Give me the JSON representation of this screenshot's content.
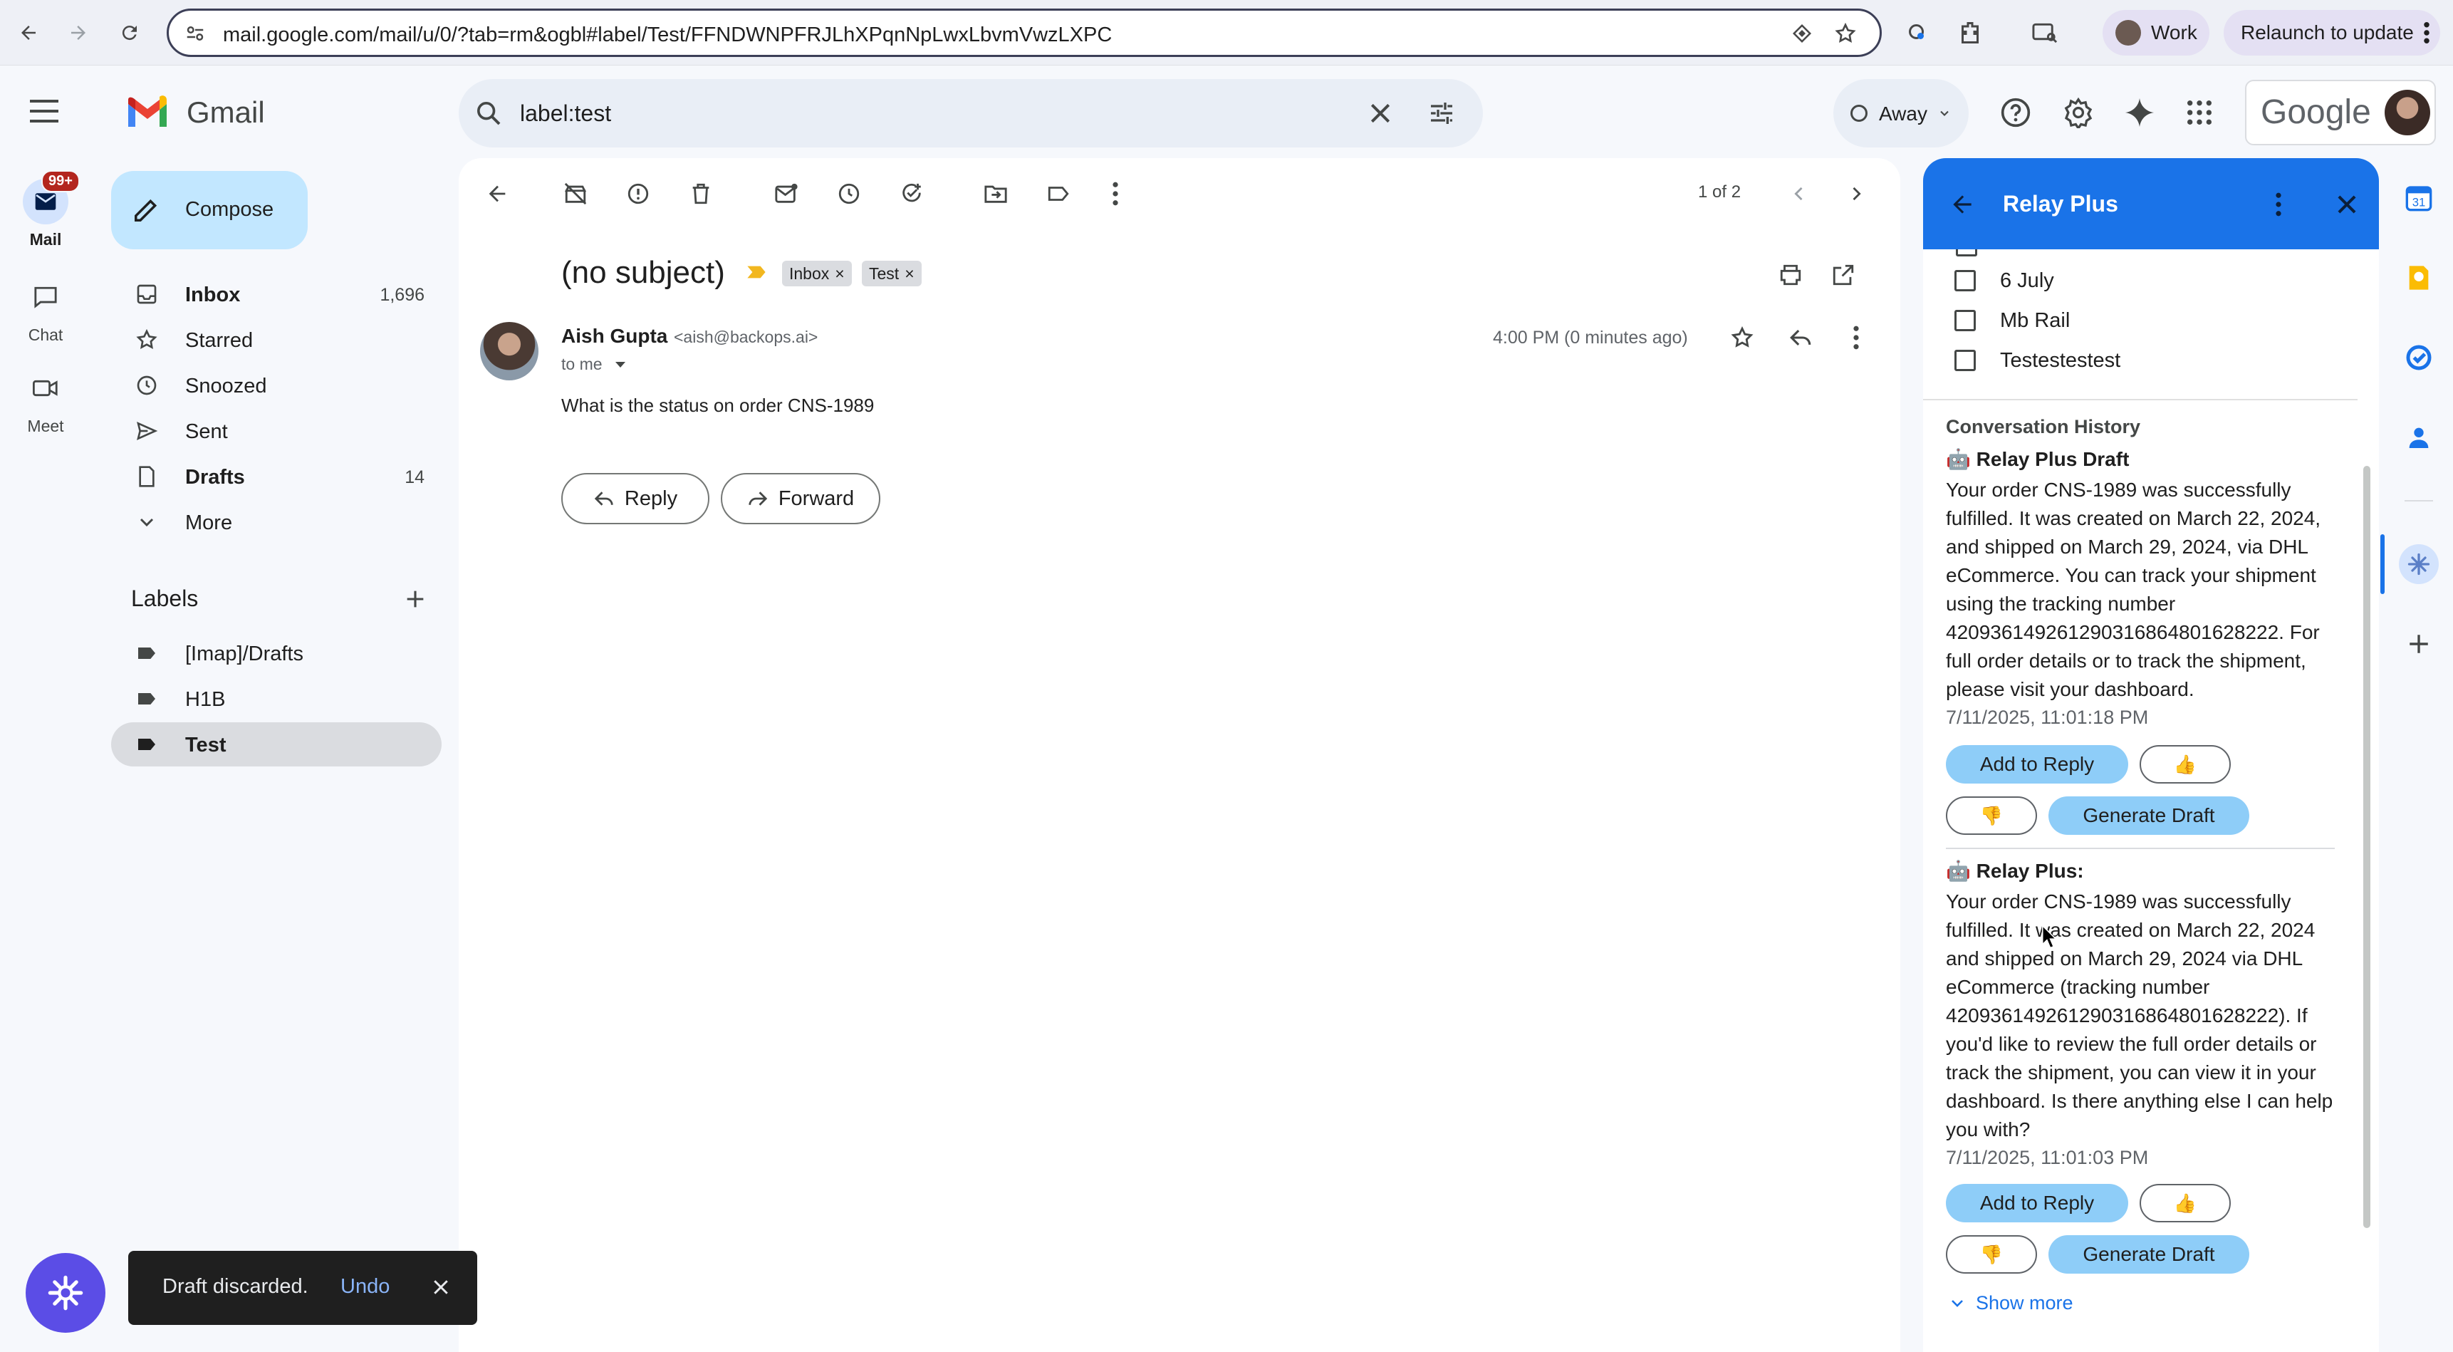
{
  "browser": {
    "url": "mail.google.com/mail/u/0/?tab=rm&ogbl#label/Test/FFNDWNPFRJLhXPqnNpLwxLbvmVwzLXPC",
    "profile_label": "Work",
    "relaunch_label": "Relaunch to update"
  },
  "rail": {
    "mail_label": "Mail",
    "mail_badge": "99+",
    "chat_label": "Chat",
    "meet_label": "Meet"
  },
  "header": {
    "app_name": "Gmail",
    "search_value": "label:test",
    "status_label": "Away",
    "google_wordmark": "Google"
  },
  "sidebar": {
    "compose_label": "Compose",
    "items": [
      {
        "label": "Inbox",
        "count": "1,696",
        "icon": "inbox-icon"
      },
      {
        "label": "Starred",
        "count": "",
        "icon": "star-icon"
      },
      {
        "label": "Snoozed",
        "count": "",
        "icon": "clock-icon"
      },
      {
        "label": "Sent",
        "count": "",
        "icon": "send-icon"
      },
      {
        "label": "Drafts",
        "count": "14",
        "icon": "draft-icon"
      },
      {
        "label": "More",
        "count": "",
        "icon": "chevron-down-icon"
      }
    ],
    "labels_heading": "Labels",
    "labels": [
      {
        "label": "[Imap]/Drafts"
      },
      {
        "label": "H1B"
      },
      {
        "label": "Test"
      }
    ]
  },
  "email": {
    "pagination": "1 of 2",
    "subject": "(no subject)",
    "chips": [
      "Inbox",
      "Test"
    ],
    "sender_name": "Aish Gupta",
    "sender_email": "<aish@backops.ai>",
    "to_line": "to me",
    "time": "4:00 PM (0 minutes ago)",
    "body": "What is the status on order CNS-1989",
    "reply_label": "Reply",
    "forward_label": "Forward"
  },
  "panel": {
    "title": "Relay Plus",
    "checkbox_labels": [
      "6 July",
      "Mb Rail",
      "Testestestest"
    ],
    "history_heading": "Conversation History",
    "entries": [
      {
        "title": "Relay Plus Draft",
        "lines": [
          "Your order CNS-1989 was successfully",
          "fulfilled. It was created on March 22, 2024,",
          "and shipped on March 29, 2024, via DHL",
          "eCommerce. You can track your shipment",
          "using the tracking number",
          "420936149261290316864801628222. For",
          "full order details or to track the shipment,",
          "please visit your dashboard."
        ],
        "timestamp": "7/11/2025, 11:01:18 PM",
        "add_label": "Add to Reply",
        "up_label": "👍",
        "down_label": "👎",
        "generate_label": "Generate Draft"
      },
      {
        "title": "Relay Plus:",
        "lines": [
          "Your order CNS-1989 was successfully",
          "fulfilled. It was created on March 22, 2024",
          "and shipped on March 29, 2024 via DHL",
          "eCommerce (tracking number",
          "420936149261290316864801628222). If",
          "you'd like to review the full order details or",
          "track the shipment, you can view it in your",
          "dashboard. Is there anything else I can help",
          "you with?"
        ],
        "timestamp": "7/11/2025, 11:01:03 PM",
        "add_label": "Add to Reply",
        "up_label": "👍",
        "down_label": "👎",
        "generate_label": "Generate Draft"
      }
    ],
    "show_more_label": "Show more"
  },
  "addons": {
    "calendar_day": "31"
  },
  "toast": {
    "message": "Draft discarded.",
    "undo_label": "Undo"
  },
  "colors": {
    "accent_blue": "#1a73e8",
    "compose_bg": "#c2e7ff",
    "selected_nav": "#d3e3fd",
    "action_button": "#8ecdf8",
    "badge_red": "#b3261e"
  }
}
